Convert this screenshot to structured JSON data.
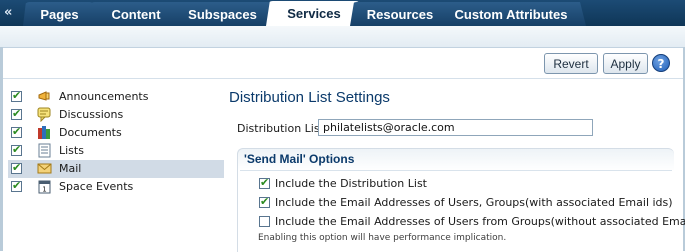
{
  "tabs": [
    {
      "label": "Pages",
      "active": false
    },
    {
      "label": "Content",
      "active": false
    },
    {
      "label": "Subspaces",
      "active": false
    },
    {
      "label": "Services",
      "active": true
    },
    {
      "label": "Resources",
      "active": false
    },
    {
      "label": "Custom Attributes",
      "active": false
    }
  ],
  "collapse_glyph": "«",
  "toolbar": {
    "revert_label": "Revert",
    "apply_label": "Apply",
    "help_glyph": "?"
  },
  "services": [
    {
      "label": "Announcements",
      "checked": true,
      "icon": "megaphone-icon",
      "selected": false
    },
    {
      "label": "Discussions",
      "checked": true,
      "icon": "discussion-icon",
      "selected": false
    },
    {
      "label": "Documents",
      "checked": true,
      "icon": "documents-icon",
      "selected": false
    },
    {
      "label": "Lists",
      "checked": true,
      "icon": "list-icon",
      "selected": false
    },
    {
      "label": "Mail",
      "checked": true,
      "icon": "mail-icon",
      "selected": true
    },
    {
      "label": "Space Events",
      "checked": true,
      "icon": "calendar-icon",
      "selected": false
    }
  ],
  "settings": {
    "title": "Distribution List Settings",
    "distribution_list_label": "Distribution List",
    "distribution_list_value": "philatelists@oracle.com",
    "section_title": "'Send Mail' Options",
    "options": [
      {
        "label": "Include the Distribution List",
        "checked": true
      },
      {
        "label": "Include the Email Addresses of Users, Groups(with associated Email ids)",
        "checked": true
      },
      {
        "label": "Include the Email Addresses of Users from Groups(without associated Email ids)",
        "checked": false
      }
    ],
    "note": "Enabling this option will have performance implication."
  },
  "colors": {
    "tabbar": "#163f66",
    "active_tab": "#ffffff",
    "title": "#0b3a6b",
    "selected_row": "#d1dbe6",
    "check": "#2a8a1f"
  }
}
